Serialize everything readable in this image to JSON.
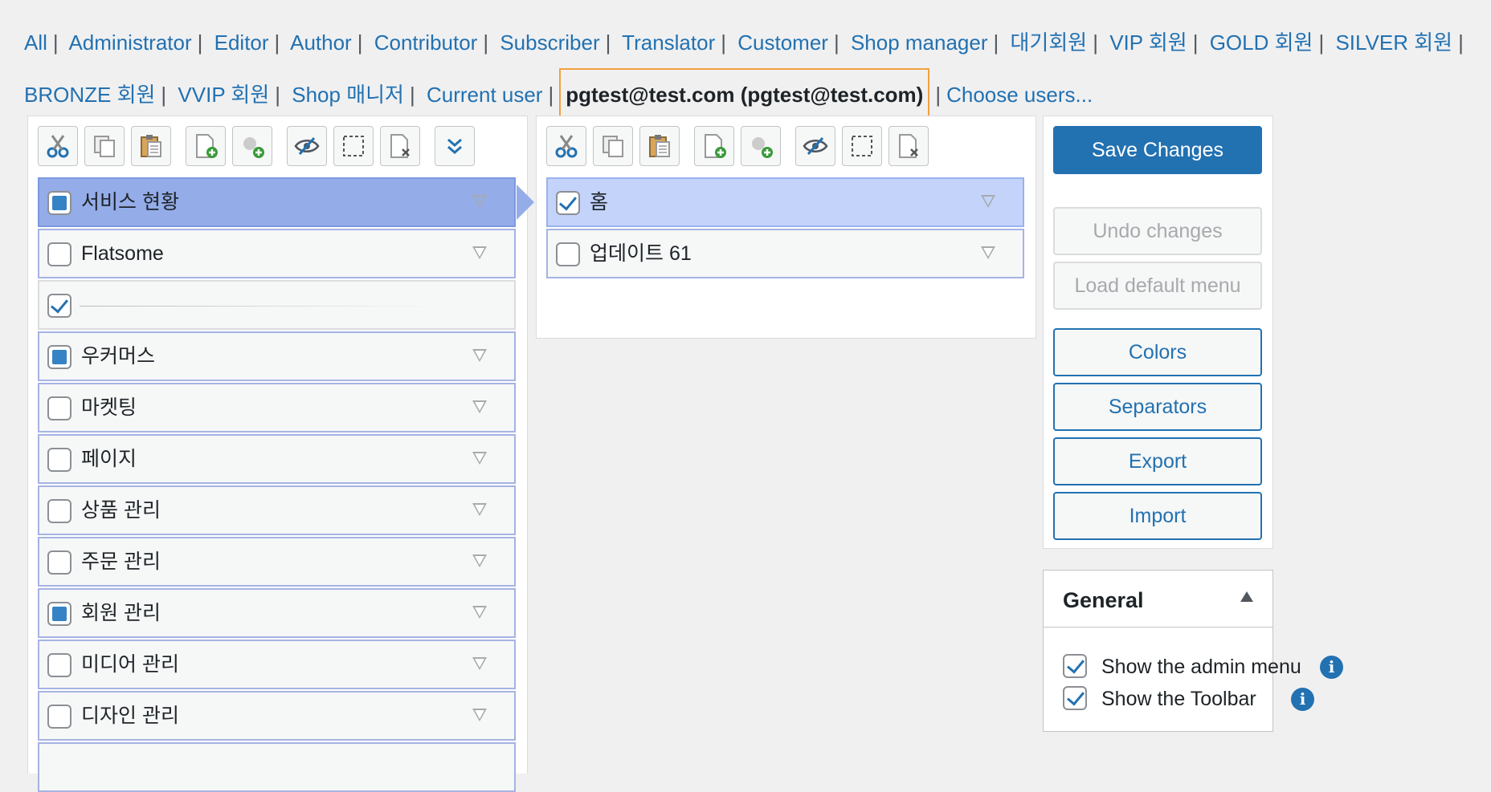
{
  "role_tabs": [
    "All",
    "Administrator",
    "Editor",
    "Author",
    "Contributor",
    "Subscriber",
    "Translator",
    "Customer",
    "Shop manager",
    "대기회원",
    "VIP 회원",
    "GOLD 회원",
    "SILVER 회원",
    "BRONZE 회원",
    "VVIP 회원",
    "Shop 매니저",
    "Current user"
  ],
  "current_user_tab": "pgtest@test.com (pgtest@test.com)",
  "choose_users": "Choose users...",
  "toolbar_icons": [
    "scissors-icon",
    "copy-icon",
    "paste-icon",
    "new-item-icon",
    "new-separator-icon",
    "hide-icon",
    "select-icon",
    "delete-icon"
  ],
  "left_menu": [
    {
      "label": "서비스 현황",
      "state": "filled"
    },
    {
      "label": "Flatsome",
      "state": "empty"
    },
    {
      "label": "",
      "state": "checked"
    },
    {
      "label": "우커머스",
      "state": "filled"
    },
    {
      "label": "마켓팅",
      "state": "empty"
    },
    {
      "label": "페이지",
      "state": "empty"
    },
    {
      "label": "상품 관리",
      "state": "empty"
    },
    {
      "label": "주문 관리",
      "state": "empty"
    },
    {
      "label": "회원 관리",
      "state": "filled"
    },
    {
      "label": "미디어 관리",
      "state": "empty"
    },
    {
      "label": "디자인 관리",
      "state": "empty"
    }
  ],
  "sub_menu": [
    {
      "label": "홈",
      "state": "checked"
    },
    {
      "label": "업데이트 61",
      "state": "empty"
    }
  ],
  "actions": {
    "save": "Save Changes",
    "undo": "Undo changes",
    "load_default": "Load default menu",
    "colors": "Colors",
    "separators": "Separators",
    "export": "Export",
    "import": "Import"
  },
  "general": {
    "title": "General",
    "show_admin_menu": "Show the admin menu",
    "show_toolbar": "Show the Toolbar",
    "info_glyph": "i"
  },
  "colors": {
    "accent": "#2271b1",
    "highlight": "#f0a140"
  }
}
